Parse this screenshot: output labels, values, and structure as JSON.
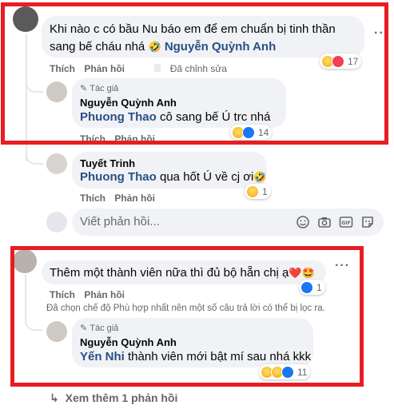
{
  "colors": {
    "highlight_box": "#e81d24",
    "mention": "#2a4f86",
    "bubble": "#f0f2f5",
    "meta": "#65676b"
  },
  "comment1": {
    "text": "Khi nào c có bầu Nu báo em để em chuẩn bị tinh thần",
    "text_line2": "sang bế cháu nhá",
    "emoji": "🤣",
    "mention": "Nguyễn Quỳnh Anh",
    "action_like": "Thích",
    "action_reply": "Phản hồi",
    "edited": "Đã chỉnh sửa",
    "reaction_icons": [
      "haha-icon",
      "heart-icon"
    ],
    "reaction_count": "17"
  },
  "reply1": {
    "author_badge": "Tác giả",
    "author": "Nguyễn Quỳnh Anh",
    "mention": "Phuong Thao",
    "text": " cô sang bế Ú trc nhá",
    "action_like": "Thích",
    "action_reply": "Phản hồi",
    "reaction_icons": [
      "haha-icon",
      "like-icon"
    ],
    "reaction_count": "14"
  },
  "reply2": {
    "author": "Tuyết Trinh",
    "mention": "Phuong Thao",
    "text": " qua hốt Ú về cj ơi",
    "emoji": "🤣",
    "action_like": "Thích",
    "action_reply": "Phản hồi",
    "reaction_icons": [
      "haha-icon"
    ],
    "reaction_count": "1"
  },
  "reply_input": {
    "placeholder": "Viết phản hồi...",
    "icons": [
      "emoji-icon",
      "camera-icon",
      "gif-icon",
      "sticker-icon"
    ],
    "gif_label": "GIF"
  },
  "comment2": {
    "text": "Thêm một thành viên nữa thì đủ bộ hẵn chị ạ",
    "emojis": "❤️🤩",
    "action_like": "Thích",
    "action_reply": "Phản hồi",
    "reaction_icons": [
      "like-icon"
    ],
    "reaction_count": "1",
    "notice": "Đã chọn chế độ Phù hợp nhất nên một số câu trả lời có thể bị lọc ra."
  },
  "reply3": {
    "author_badge": "Tác giả",
    "author": "Nguyễn Quỳnh Anh",
    "mention": "Yến Nhi",
    "text": " thành viên mới bật mí sau nhá kkk",
    "reaction_icons": [
      "haha-icon",
      "wow-icon",
      "like-icon"
    ],
    "reaction_count": "11"
  },
  "see_more": {
    "arrow": "↳",
    "label": "Xem thêm 1 phản hồi"
  }
}
